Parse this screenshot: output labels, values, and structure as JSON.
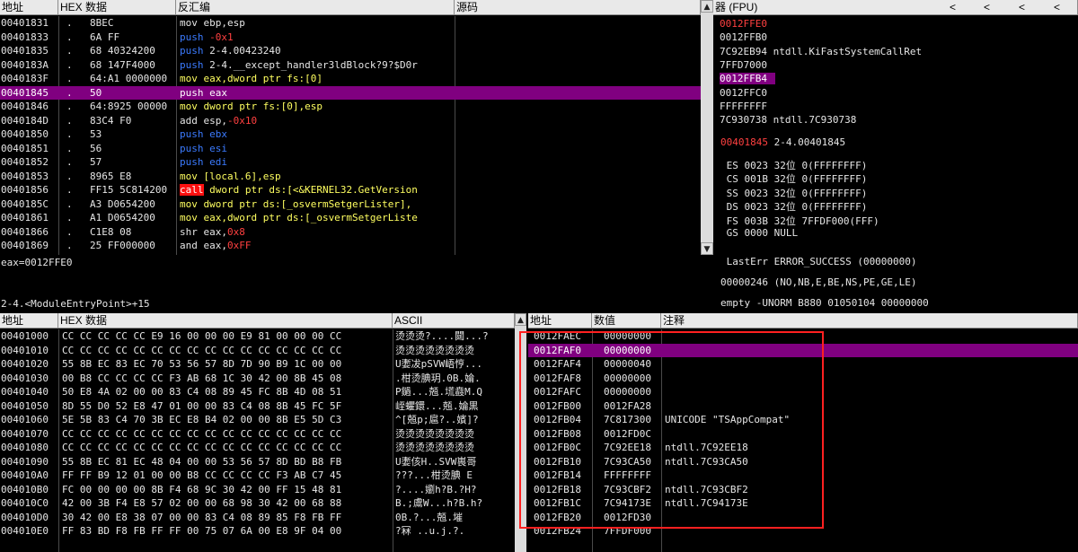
{
  "disasm": {
    "headers": [
      "地址",
      "HEX 数据",
      "反汇编",
      "源码"
    ],
    "rows": [
      {
        "addr": "00401831",
        "dot": ".",
        "hex": "8BEC",
        "asm": [
          [
            "",
            "mov ebp,esp"
          ]
        ]
      },
      {
        "addr": "00401833",
        "dot": ".",
        "hex": "6A FF",
        "asm": [
          [
            "blue",
            "push"
          ],
          [
            "red",
            " -0x1"
          ]
        ]
      },
      {
        "addr": "00401835",
        "dot": ".",
        "hex": "68 40324200",
        "asm": [
          [
            "blue",
            "push"
          ],
          [
            "",
            " 2-4.00423240"
          ]
        ]
      },
      {
        "addr": "0040183A",
        "dot": ".",
        "hex": "68 147F4000",
        "asm": [
          [
            "blue",
            "push"
          ],
          [
            "",
            " 2-4.__except_handler3ldBlock?9?$D0r"
          ]
        ]
      },
      {
        "addr": "0040183F",
        "dot": ".",
        "hex": "64:A1 0000000",
        "asm": [
          [
            "yellow",
            "mov eax,dword ptr fs:[0]"
          ]
        ]
      },
      {
        "addr": "00401845",
        "dot": ".",
        "hex": "50",
        "asm": [
          [
            "",
            "push eax"
          ]
        ],
        "selected": true
      },
      {
        "addr": "00401846",
        "dot": ".",
        "hex": "64:8925 00000",
        "asm": [
          [
            "yellow",
            "mov dword ptr fs:[0],esp"
          ]
        ]
      },
      {
        "addr": "0040184D",
        "dot": ".",
        "hex": "83C4 F0",
        "asm": [
          [
            "",
            "add esp,"
          ],
          [
            "red",
            "-0x10"
          ]
        ]
      },
      {
        "addr": "00401850",
        "dot": ".",
        "hex": "53",
        "asm": [
          [
            "blue",
            "push ebx"
          ]
        ]
      },
      {
        "addr": "00401851",
        "dot": ".",
        "hex": "56",
        "asm": [
          [
            "blue",
            "push esi"
          ]
        ]
      },
      {
        "addr": "00401852",
        "dot": ".",
        "hex": "57",
        "asm": [
          [
            "blue",
            "push edi"
          ]
        ]
      },
      {
        "addr": "00401853",
        "dot": ".",
        "hex": "8965 E8",
        "asm": [
          [
            "yellow",
            "mov [local.6],esp"
          ]
        ]
      },
      {
        "addr": "00401856",
        "dot": ".",
        "hex": "FF15 5C814200",
        "asm": [
          [
            "callbox",
            "call"
          ],
          [
            "yellow",
            " dword ptr ds:[<&KERNEL32.GetVersion"
          ]
        ]
      },
      {
        "addr": "0040185C",
        "dot": ".",
        "hex": "A3 D0654200",
        "asm": [
          [
            "yellow",
            "mov dword ptr ds:[_osvermSetgerLister],"
          ]
        ]
      },
      {
        "addr": "00401861",
        "dot": ".",
        "hex": "A1 D0654200",
        "asm": [
          [
            "yellow",
            "mov eax,dword ptr ds:[_osvermSetgerListe"
          ]
        ]
      },
      {
        "addr": "00401866",
        "dot": ".",
        "hex": "C1E8 08",
        "asm": [
          [
            "",
            "shr eax,"
          ],
          [
            "red",
            "0x8"
          ]
        ]
      },
      {
        "addr": "00401869",
        "dot": ".",
        "hex": "25 FF000000",
        "asm": [
          [
            "",
            "and eax,"
          ],
          [
            "red",
            "0xFF"
          ]
        ]
      }
    ]
  },
  "info": {
    "line1": "eax=0012FFE0",
    "line2": "2-4.<ModuleEntryPoint>+15"
  },
  "registers": {
    "header": "器 (FPU)",
    "nav": [
      "<",
      "<",
      "<",
      "<"
    ],
    "stack_lines": [
      {
        "text": "0012FFE0",
        "cls": "red"
      },
      {
        "text": "0012FFB0",
        "cls": ""
      },
      {
        "text": "7C92EB94 ntdll.KiFastSystemCallRet",
        "cls": ""
      },
      {
        "text": "7FFD7000",
        "cls": ""
      },
      {
        "text": "0012FFB4",
        "cls": "sel"
      },
      {
        "text": "0012FFC0",
        "cls": ""
      },
      {
        "text": "FFFFFFFF",
        "cls": ""
      },
      {
        "text": "7C930738 ntdll.7C930738",
        "cls": ""
      }
    ],
    "eip_addr": "00401845",
    "eip_text": " 2-4.00401845",
    "segments": [
      " ES 0023 32位 0(FFFFFFFF)",
      " CS 001B 32位 0(FFFFFFFF)",
      " SS 0023 32位 0(FFFFFFFF)",
      " DS 0023 32位 0(FFFFFFFF)",
      " FS 003B 32位 7FFDF000(FFF)",
      " GS 0000 NULL"
    ],
    "lasterr": " LastErr ERROR_SUCCESS (00000000)",
    "efl": "00000246 (NO,NB,E,BE,NS,PE,GE,LE)",
    "fpu": "empty -UNORM B880 01050104 00000000"
  },
  "dump": {
    "headers": [
      "地址",
      "HEX 数据",
      "ASCII"
    ],
    "rows": [
      {
        "addr": "00401000",
        "hex": "CC CC CC CC CC E9 16 00 00 00 E9 81 00 00 00 CC",
        "ascii": "烫烫烫?....閮...?"
      },
      {
        "addr": "00401010",
        "hex": "CC CC CC CC CC CC CC CC CC CC CC CC CC CC CC CC",
        "ascii": "烫烫烫烫烫烫烫烫"
      },
      {
        "addr": "00401020",
        "hex": "55 8B EC 83 EC 70 53 56 57 8D 7D 90 B9 1C 00 00",
        "ascii": "U嬱冹pSVW峿悙..."
      },
      {
        "addr": "00401030",
        "hex": "00 B8 CC CC CC CC F3 AB 68 1C 30 42 00 8B 45 08",
        "ascii": ".柑烫腆玥.0B.婨."
      },
      {
        "addr": "00401040",
        "hex": "50 E8 4A 02 00 00 83 C4 08 89 45 FC 8B 4D 08 51",
        "ascii": "P鐹...兡.塃鼖M.Q"
      },
      {
        "addr": "00401050",
        "hex": "8D 55 D0 52 E8 47 01 00 00 83 C4 08 8B 45 FC 5F",
        "ascii": "峌蠷鐶...兡.婨黒"
      },
      {
        "addr": "00401060",
        "hex": "5E 5B 83 C4 70 3B EC E8 B4 02 00 00 8B E5 5D C3",
        "ascii": "^[兡p;扈?..嬪]?"
      },
      {
        "addr": "00401070",
        "hex": "CC CC CC CC CC CC CC CC CC CC CC CC CC CC CC CC",
        "ascii": "烫烫烫烫烫烫烫烫"
      },
      {
        "addr": "00401080",
        "hex": "CC CC CC CC CC CC CC CC CC CC CC CC CC CC CC CC",
        "ascii": "烫烫烫烫烫烫烫烫"
      },
      {
        "addr": "00401090",
        "hex": "55 8B EC 81 EC 48 04 00 00 53 56 57 8D BD B8 FB",
        "ascii": "U嬱侅H..SVW嵔哥"
      },
      {
        "addr": "004010A0",
        "hex": "FF FF B9 12 01 00 00 B8 CC CC CC CC F3 AB C7 45",
        "ascii": "???...柑烫腆 E"
      },
      {
        "addr": "004010B0",
        "hex": "FC 00 00 00 00 8B F4 68 9C 30 42 00 FF 15 48 81",
        "ascii": "?....嬼h?B.?H?"
      },
      {
        "addr": "004010C0",
        "hex": "42 00 3B F4 E8 57 02 00 00 68 98 30 42 00 68 88",
        "ascii": "B.;鬳W...h?B.h?"
      },
      {
        "addr": "004010D0",
        "hex": "30 42 00 E8 38 07 00 00 83 C4 08 89 85 F8 FB FF",
        "ascii": "0B.?...兡.墔 "
      },
      {
        "addr": "004010E0",
        "hex": "FF 83 BD F8 FB FF FF 00 75 07 6A 00 E8 9F 04 00",
        "ascii": "?冧 ..u.j.?."
      }
    ]
  },
  "stack": {
    "headers": [
      "地址",
      "数值",
      "注释"
    ],
    "rows": [
      {
        "addr": "0012FAEC",
        "val": "00000000",
        "note": ""
      },
      {
        "addr": "0012FAF0",
        "val": "00000000",
        "note": "",
        "selected": true
      },
      {
        "addr": "0012FAF4",
        "val": "00000040",
        "note": ""
      },
      {
        "addr": "0012FAF8",
        "val": "00000000",
        "note": ""
      },
      {
        "addr": "0012FAFC",
        "val": "00000000",
        "note": ""
      },
      {
        "addr": "0012FB00",
        "val": "0012FA28",
        "note": ""
      },
      {
        "addr": "0012FB04",
        "val": "7C817300",
        "note": "UNICODE \"TSAppCompat\""
      },
      {
        "addr": "0012FB08",
        "val": "0012FD0C",
        "note": ""
      },
      {
        "addr": "0012FB0C",
        "val": "7C92EE18",
        "note": "ntdll.7C92EE18"
      },
      {
        "addr": "0012FB10",
        "val": "7C93CA50",
        "note": "ntdll.7C93CA50"
      },
      {
        "addr": "0012FB14",
        "val": "FFFFFFFF",
        "note": ""
      },
      {
        "addr": "0012FB18",
        "val": "7C93CBF2",
        "note": "ntdll.7C93CBF2"
      },
      {
        "addr": "0012FB1C",
        "val": "7C94173E",
        "note": "ntdll.7C94173E"
      },
      {
        "addr": "0012FB20",
        "val": "0012FD30",
        "note": ""
      },
      {
        "addr": "0012FB24",
        "val": "7FFDF000",
        "note": ""
      }
    ]
  },
  "colors": {
    "selection": "#800080",
    "annotation": "#ff2020",
    "header_bg": "#e9e9e9"
  }
}
